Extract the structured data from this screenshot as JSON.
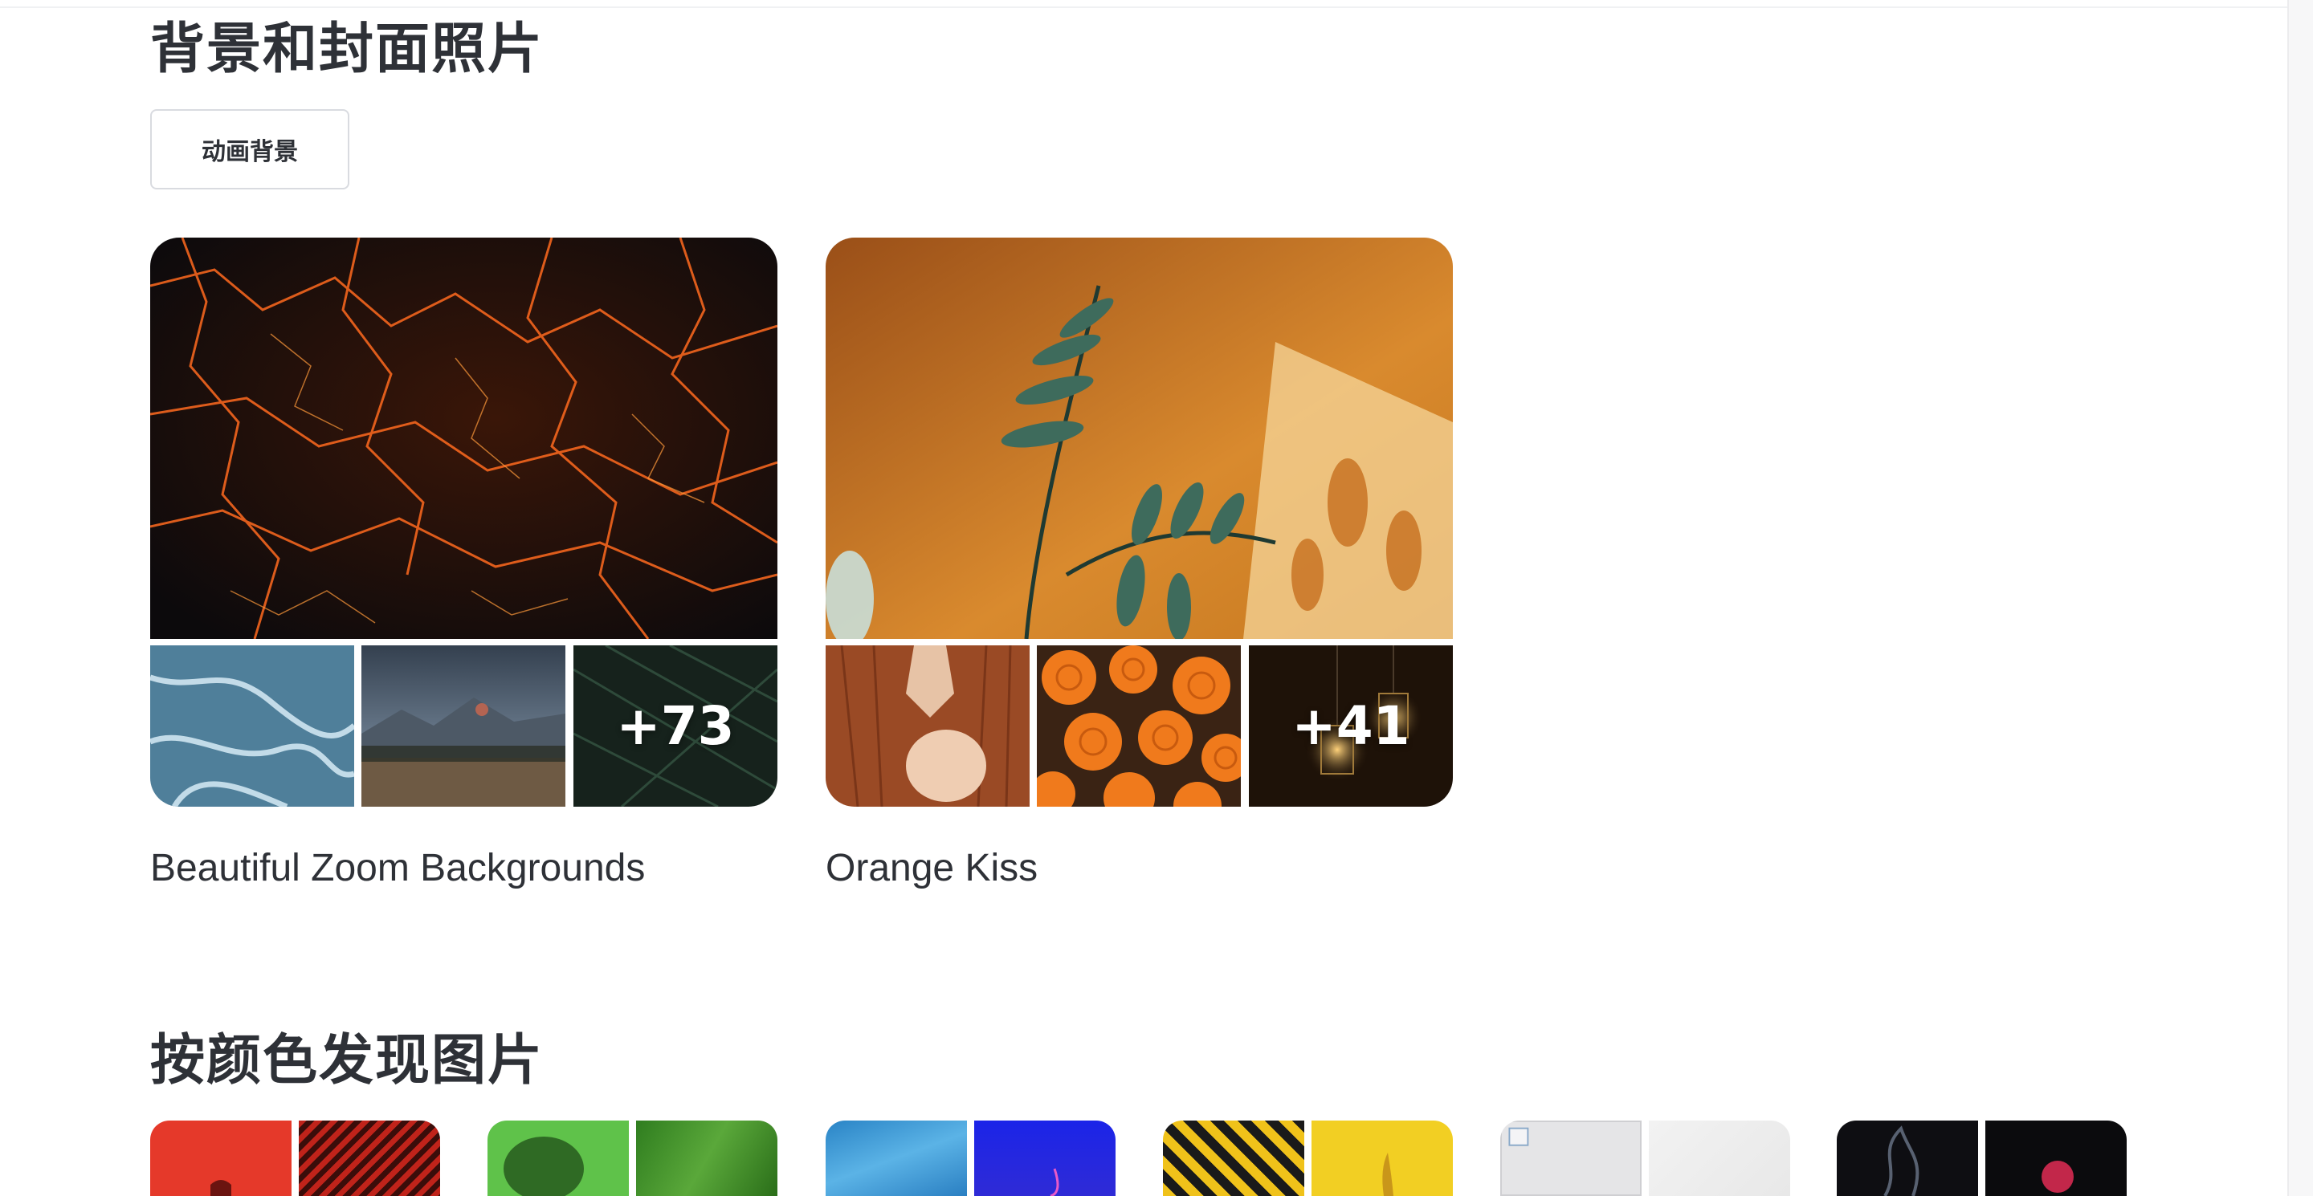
{
  "backgrounds_section": {
    "title": "背景和封面照片",
    "animated_button_label": "动画背景"
  },
  "collections": [
    {
      "title": "Beautiful Zoom Backgrounds",
      "more_count": "+73"
    },
    {
      "title": "Orange Kiss",
      "more_count": "+41"
    }
  ],
  "color_section": {
    "title": "按颜色发现图片",
    "swatches": [
      "red",
      "green",
      "blue",
      "yellow",
      "white",
      "black"
    ]
  }
}
